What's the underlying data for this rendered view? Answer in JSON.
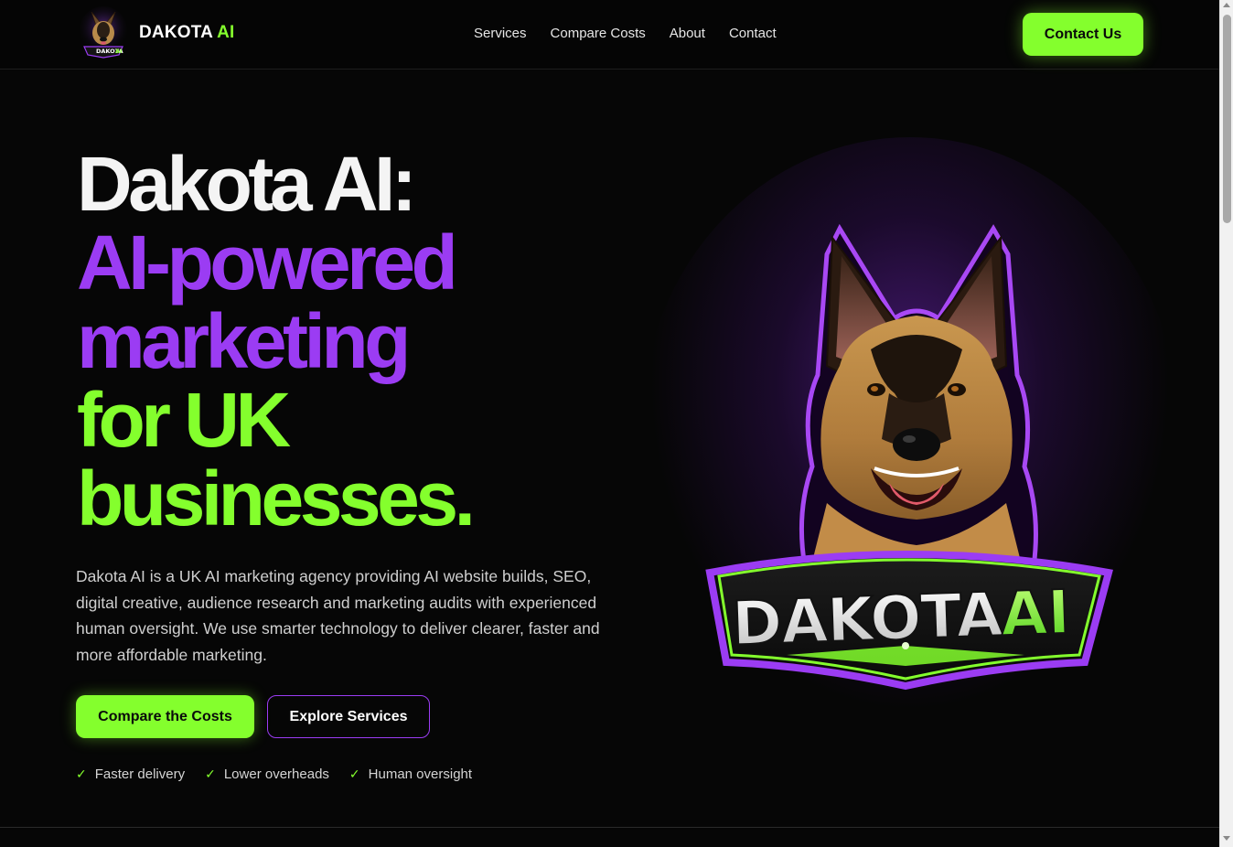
{
  "header": {
    "brand": {
      "name_main": "DAKOTA",
      "name_accent": "AI",
      "logo_icon": "dakota-dog-logo-icon"
    },
    "nav": [
      {
        "label": "Services"
      },
      {
        "label": "Compare Costs"
      },
      {
        "label": "About"
      },
      {
        "label": "Contact"
      }
    ],
    "cta_label": "Contact Us"
  },
  "hero": {
    "title_lines": [
      "Dakota AI:",
      "AI-powered",
      "marketing",
      "for UK",
      "businesses."
    ],
    "description": "Dakota AI is a UK AI marketing agency providing AI website builds, SEO, digital creative, audience research and marketing audits with experienced human oversight. We use smarter technology to deliver clearer, faster and more affordable marketing.",
    "primary_button": "Compare the Costs",
    "secondary_button": "Explore Services",
    "features": [
      "Faster delivery",
      "Lower overheads",
      "Human oversight"
    ],
    "feature_icon": "check-icon",
    "art": {
      "icon": "dakota-ai-dog-badge-icon",
      "badge_main": "DAKOTA",
      "badge_accent": "AI"
    }
  },
  "colors": {
    "background": "#060606",
    "accent_green": "#84ff2d",
    "accent_purple": "#9b3cf3",
    "text": "#e8e8e8"
  }
}
